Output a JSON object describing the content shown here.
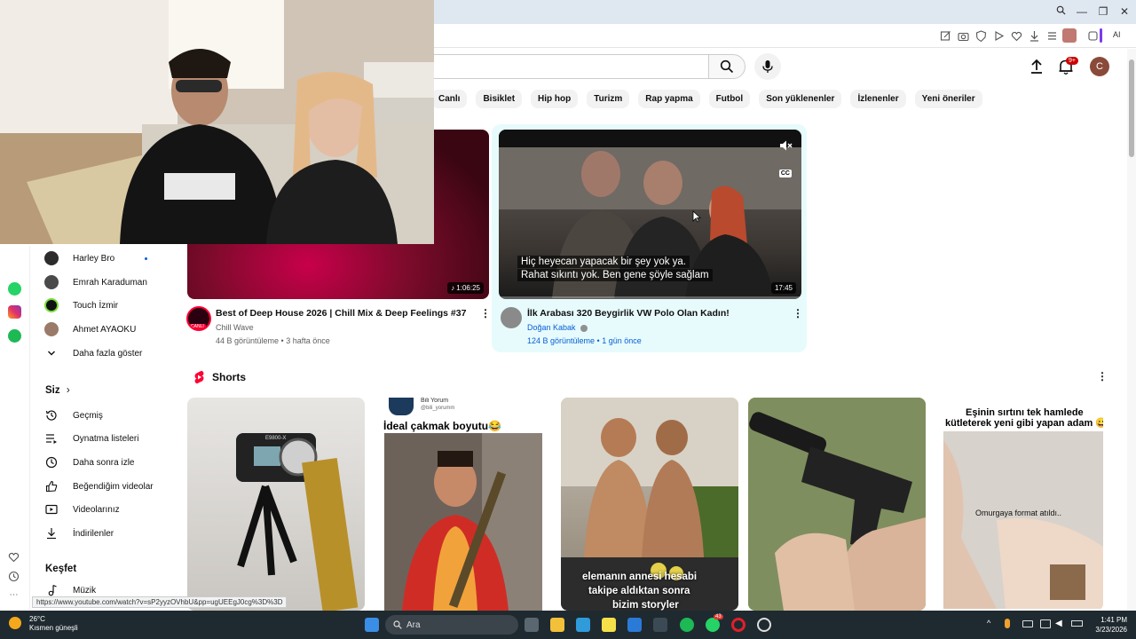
{
  "browser": {
    "toolbar_ai_label": "AI"
  },
  "header": {
    "notification_badge": "9+",
    "avatar_letter": "C"
  },
  "chips": [
    "Canlı",
    "Bisiklet",
    "Hip hop",
    "Turizm",
    "Rap yapma",
    "Futbol",
    "Son yüklenenler",
    "İzlenenler",
    "Yeni öneriler"
  ],
  "sidebar": {
    "subscriptions": [
      {
        "label": "Harley Bro",
        "live_dot": true,
        "color": "#222"
      },
      {
        "label": "Emrah Karaduman",
        "color": "#555"
      },
      {
        "label": "Touch İzmir",
        "color": "#1a1a1a"
      },
      {
        "label": "Ahmet AYAOKU",
        "color": "#8a6a5a"
      }
    ],
    "show_more": "Daha fazla göster",
    "you_heading": "Siz",
    "you_items": [
      "Geçmiş",
      "Oynatma listeleri",
      "Daha sonra izle",
      "Beğendiğim videolar",
      "Videolarınız",
      "İndirilenler"
    ],
    "explore_heading": "Keşfet",
    "explore_items": [
      "Müzik"
    ]
  },
  "videos": [
    {
      "title": "Best of Deep House 2026 | Chill Mix & Deep Feelings #37",
      "channel": "Chill Wave",
      "meta": "44 B görüntüleme • 3 hafta önce",
      "duration": "1:06:25",
      "live_badge": "CANLI"
    },
    {
      "title": "İlk Arabası 320 Beygirlik VW Polo Olan Kadın!",
      "channel": "Doğan Kabak",
      "meta": "124 B görüntüleme • 1 gün önce",
      "duration": "17:45",
      "subtitles": [
        "Hiç heyecan yapacak bir şey yok ya.",
        "Rahat sıkıntı yok. Ben gene şöyle sağlam"
      ],
      "cc_label": "CC"
    }
  ],
  "shorts": {
    "heading": "Shorts",
    "items": [
      {
        "caption": "",
        "device_label": "E9800-X"
      },
      {
        "caption": "İdeal çakmak boyutu😂",
        "channel": "Bili Yorum",
        "handle": "@bili_yorumm"
      },
      {
        "caption_lines": [
          "elemanın annesi hesabi",
          "takipe aldıktan sonra",
          "bizim storyler"
        ]
      },
      {
        "caption": ""
      },
      {
        "caption_lines": [
          "Eşinin sırtını tek hamlede",
          "kütleterek yeni gibi yapan adam 😀"
        ],
        "overlay": "Omurgaya format atıldı.."
      }
    ]
  },
  "status_url": "https://www.youtube.com/watch?v=sP2yyzOVhbU&pp=ugUEEgJ0cg%3D%3D",
  "taskbar": {
    "weather_temp": "26°C",
    "weather_desc": "Kısmen güneşli",
    "search_label": "Ara",
    "whatsapp_badge": "43",
    "time": "1:41 PM",
    "date": "3/23/2026"
  },
  "colors": {
    "accent_red": "#ff0033",
    "hover_card_bg": "#e7fbfd",
    "taskbar_bg": "#1f2a30"
  }
}
